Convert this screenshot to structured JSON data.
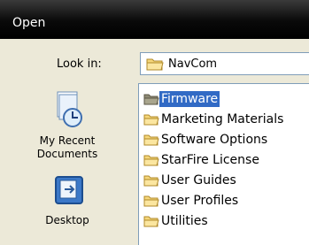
{
  "window": {
    "title": "Open"
  },
  "lookin": {
    "label": "Look in:",
    "value": "NavCom"
  },
  "places": [
    {
      "label_line1": "My Recent",
      "label_line2": "Documents"
    },
    {
      "label_line1": "Desktop"
    }
  ],
  "files": [
    {
      "name": "Firmware",
      "selected": true
    },
    {
      "name": "Marketing Materials"
    },
    {
      "name": "Software Options"
    },
    {
      "name": "StarFire License"
    },
    {
      "name": "User Guides"
    },
    {
      "name": "User Profiles"
    },
    {
      "name": "Utilities"
    }
  ],
  "colors": {
    "titlebar": "#000000",
    "selection": "#316ac5",
    "folder": "#f5d67a",
    "selected_folder": "#8e8a74"
  }
}
